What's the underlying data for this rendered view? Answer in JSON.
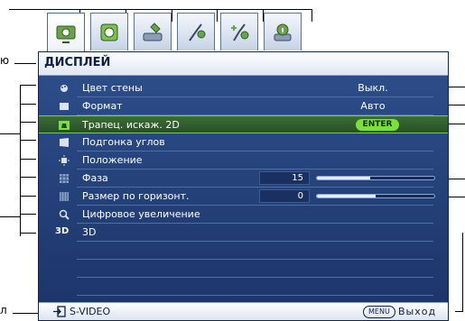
{
  "tabs": [
    {
      "name": "display-tab",
      "icon": "display-settings-icon",
      "active": true
    },
    {
      "name": "picture-tab",
      "icon": "picture-icon",
      "active": false
    },
    {
      "name": "source-tab",
      "icon": "source-icon",
      "active": false
    },
    {
      "name": "system-setup-basic-tab",
      "icon": "system-setup-icon",
      "active": false
    },
    {
      "name": "system-setup-advanced-tab",
      "icon": "advanced-setup-icon",
      "active": false
    },
    {
      "name": "information-tab",
      "icon": "information-icon",
      "active": false
    }
  ],
  "callouts": {
    "menu_label_fragment": "ю",
    "source_label_fragment": "л"
  },
  "header": {
    "title": "ДИСПЛЕЙ"
  },
  "rows": [
    {
      "label": "Цвет стены",
      "value": "Выкл.",
      "icon": "wall-color-icon"
    },
    {
      "label": "Формат",
      "value": "Авто",
      "icon": "aspect-ratio-icon"
    },
    {
      "label": "Трапец. искаж. 2D",
      "badge": "ENTER",
      "icon": "keystone-icon",
      "selected": true
    },
    {
      "label": "Подгонка углов",
      "icon": "corner-fit-icon"
    },
    {
      "label": "Положение",
      "icon": "position-icon"
    },
    {
      "label": "Фаза",
      "number": "15",
      "slider_fraction": 0.45,
      "icon": "phase-icon"
    },
    {
      "label": "Размер по горизонт.",
      "number": "0",
      "slider_fraction": 0.5,
      "icon": "h-size-icon"
    },
    {
      "label": "Цифровое увеличение",
      "icon": "digital-zoom-icon"
    },
    {
      "label": "3D",
      "icon_text": "3D",
      "icon": "3d-icon"
    }
  ],
  "footer": {
    "source": "S-VIDEO",
    "menu_key": "MENU",
    "exit": "Выход"
  },
  "colors": {
    "panel_bg": "#2e4f8c",
    "selected_border": "#7ccf4a",
    "enter_badge": "#7ce03a"
  }
}
